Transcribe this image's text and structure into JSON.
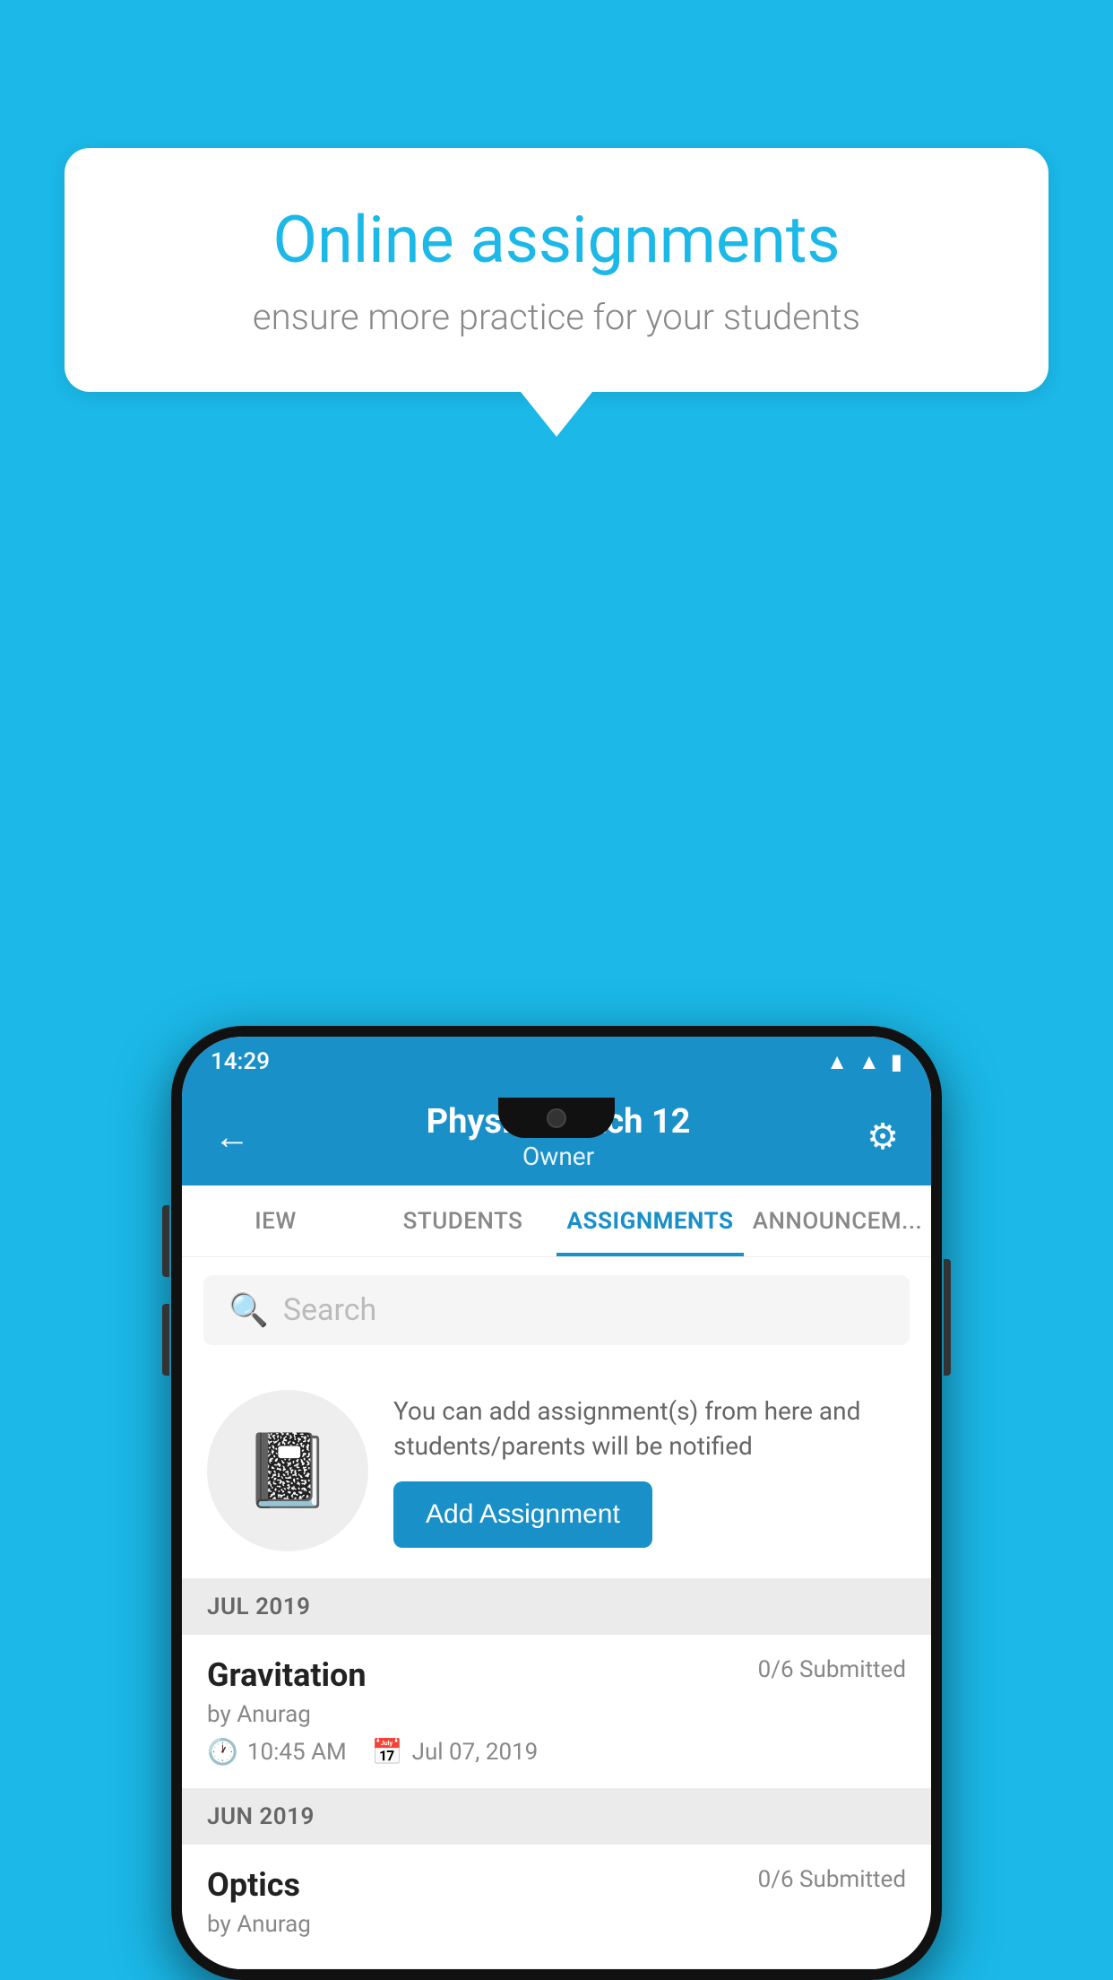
{
  "background_color": "#1BB8E8",
  "speech_bubble": {
    "title": "Online assignments",
    "subtitle": "ensure more practice for your students"
  },
  "status_bar": {
    "time": "14:29",
    "icons": [
      "wifi",
      "signal",
      "battery"
    ]
  },
  "header": {
    "title": "Physics Batch 12",
    "subtitle": "Owner",
    "back_label": "←",
    "gear_label": "⚙"
  },
  "tabs": [
    {
      "label": "IEW",
      "active": false
    },
    {
      "label": "STUDENTS",
      "active": false
    },
    {
      "label": "ASSIGNMENTS",
      "active": true
    },
    {
      "label": "ANNOUNCEM...",
      "active": false
    }
  ],
  "search": {
    "placeholder": "Search"
  },
  "promo": {
    "text": "You can add assignment(s) from here and students/parents will be notified",
    "button_label": "Add Assignment"
  },
  "sections": [
    {
      "month": "JUL 2019",
      "assignments": [
        {
          "name": "Gravitation",
          "submitted": "0/6 Submitted",
          "by": "by Anurag",
          "time": "10:45 AM",
          "date": "Jul 07, 2019"
        }
      ]
    },
    {
      "month": "JUN 2019",
      "assignments": [
        {
          "name": "Optics",
          "submitted": "0/6 Submitted",
          "by": "by Anurag",
          "time": "",
          "date": ""
        }
      ]
    }
  ]
}
